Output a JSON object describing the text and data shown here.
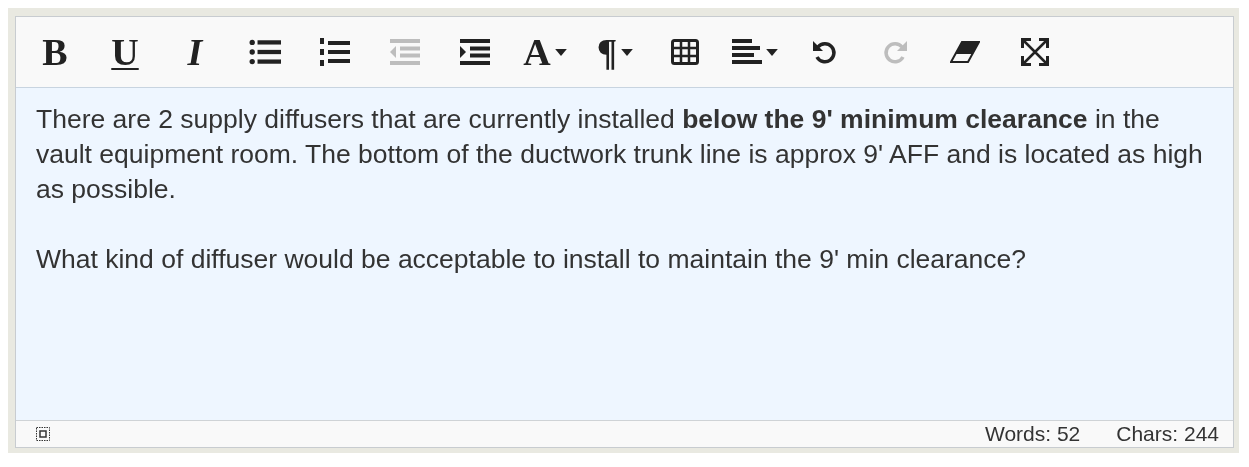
{
  "toolbar": [
    {
      "kind": "bold",
      "label": "B",
      "disabled": false,
      "dropdown": false
    },
    {
      "kind": "underline",
      "label": "U",
      "disabled": false,
      "dropdown": false
    },
    {
      "kind": "italic",
      "label": "I",
      "disabled": false,
      "dropdown": false
    },
    {
      "kind": "bullet-list",
      "disabled": false,
      "dropdown": false
    },
    {
      "kind": "numbered-list",
      "disabled": false,
      "dropdown": false
    },
    {
      "kind": "outdent",
      "disabled": true,
      "dropdown": false
    },
    {
      "kind": "indent",
      "disabled": false,
      "dropdown": false
    },
    {
      "kind": "font",
      "label": "A",
      "disabled": false,
      "dropdown": true
    },
    {
      "kind": "paragraph",
      "label": "¶",
      "disabled": false,
      "dropdown": true
    },
    {
      "kind": "table",
      "disabled": false,
      "dropdown": false
    },
    {
      "kind": "align",
      "disabled": false,
      "dropdown": true
    },
    {
      "kind": "undo",
      "disabled": false,
      "dropdown": false
    },
    {
      "kind": "redo",
      "disabled": true,
      "dropdown": false
    },
    {
      "kind": "eraser",
      "disabled": false,
      "dropdown": false
    },
    {
      "kind": "fullscreen",
      "disabled": false,
      "dropdown": false
    }
  ],
  "content": {
    "paragraphs": [
      "There are 2 supply diffusers that are currently installed **below the 9' minimum clearance** in the vault equipment room. The bottom of the ductwork trunk line is approx 9' AFF and is located as high as possible.",
      "What kind of diffuser would be acceptable to install to maintain the 9' min clearance?"
    ]
  },
  "status_bar": {
    "words": "Words: 52",
    "chars": "Chars: 244"
  }
}
